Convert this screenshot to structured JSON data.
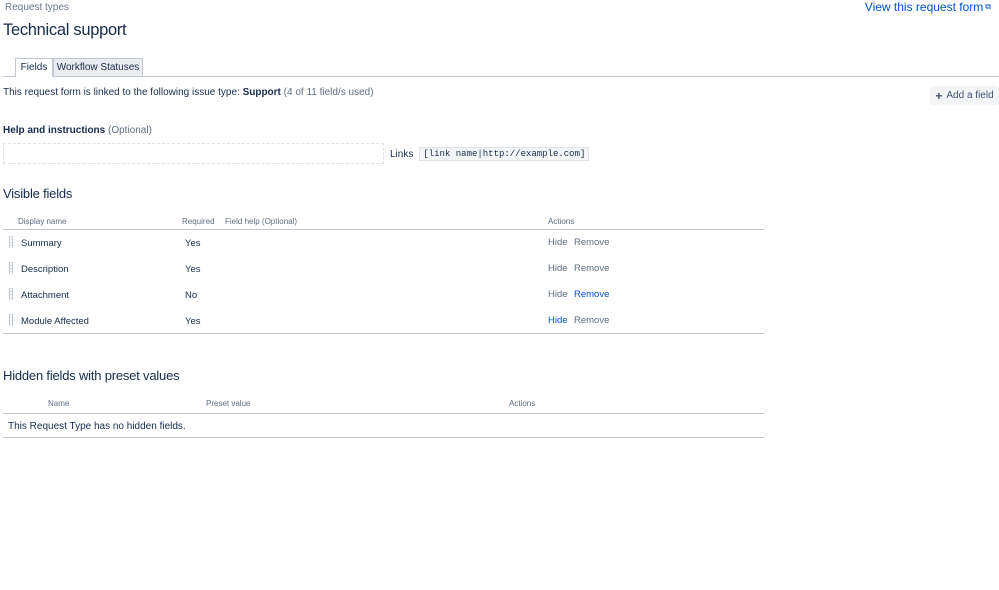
{
  "header": {
    "breadcrumb": "Request types",
    "view_link": "View this request form",
    "title": "Technical support"
  },
  "tabs": [
    {
      "label": "Fields",
      "active": true
    },
    {
      "label": "Workflow Statuses",
      "active": false
    }
  ],
  "linked": {
    "prefix": "This request form is linked to the following issue type:",
    "issue_type": "Support",
    "usage": "(4 of 11 field/s used)"
  },
  "add_field_label": "Add a field",
  "help": {
    "label": "Help and instructions",
    "optional": "(Optional)",
    "value": "",
    "links_label": "Links",
    "links_syntax": "[link name|http://example.com]"
  },
  "visible_fields": {
    "title": "Visible fields",
    "columns": {
      "display_name": "Display name",
      "required": "Required",
      "field_help": "Field help (Optional)",
      "actions": "Actions"
    },
    "rows": [
      {
        "name": "Summary",
        "required": "Yes",
        "hide": "Hide",
        "remove": "Remove"
      },
      {
        "name": "Description",
        "required": "Yes",
        "hide": "Hide",
        "remove": "Remove"
      },
      {
        "name": "Attachment",
        "required": "No",
        "hide": "Hide",
        "remove": "Remove"
      },
      {
        "name": "Module Affected",
        "required": "Yes",
        "hide": "Hide",
        "remove": "Remove"
      }
    ]
  },
  "hidden_fields": {
    "title": "Hidden fields with preset values",
    "columns": {
      "name": "Name",
      "preset_value": "Preset value",
      "actions": "Actions"
    },
    "empty_message": "This Request Type has no hidden fields."
  },
  "colors": {
    "link": "#0052cc",
    "text": "#172b4d",
    "muted": "#5e6c84",
    "border": "#c1c7d0"
  },
  "icons": {
    "external_link": "external-link-icon",
    "add": "plus-icon",
    "drag": "drag-handle-icon"
  }
}
